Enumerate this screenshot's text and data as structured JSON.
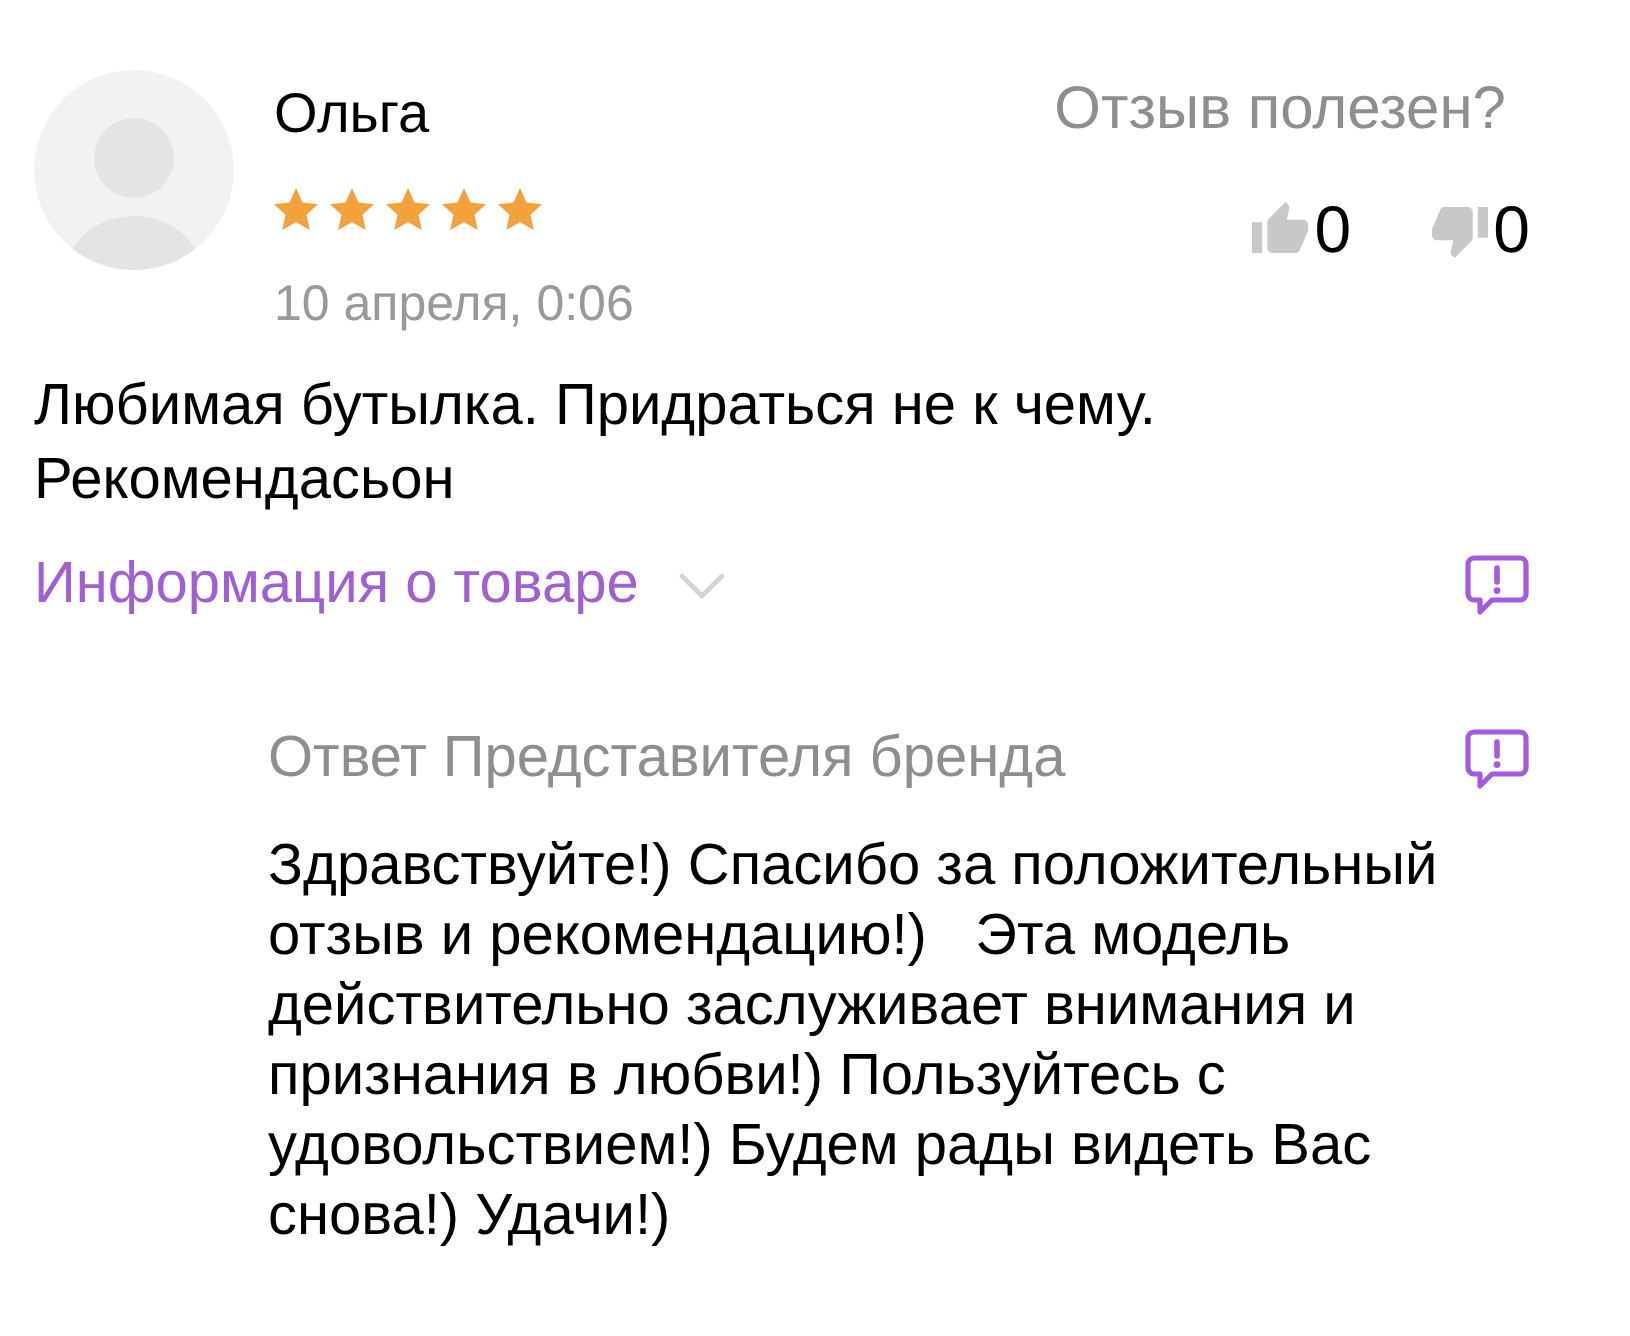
{
  "review": {
    "author": "Ольга",
    "stars": 5,
    "date": "10 апреля, 0:06",
    "text": "Любимая бутылка. Придраться не к чему. Рекомендасьон"
  },
  "helpful": {
    "question": "Отзыв полезен?",
    "votes": [
      {
        "kind": "up",
        "count": "0",
        "selected": false
      },
      {
        "kind": "down",
        "count": "0",
        "selected": false
      }
    ]
  },
  "product_info": {
    "label": "Информация о товаре",
    "expanded": false
  },
  "brand_reply": {
    "title": "Ответ Представителя бренда",
    "text": "Здравствуйте!) Спасибо за положительный отзыв и рекомендацию!)   Эта модель действительно заслуживает внимания и признания в любви!) Пользуйтесь с удовольствием!) Будем рады видеть Вас снова!) Удачи!)"
  }
}
